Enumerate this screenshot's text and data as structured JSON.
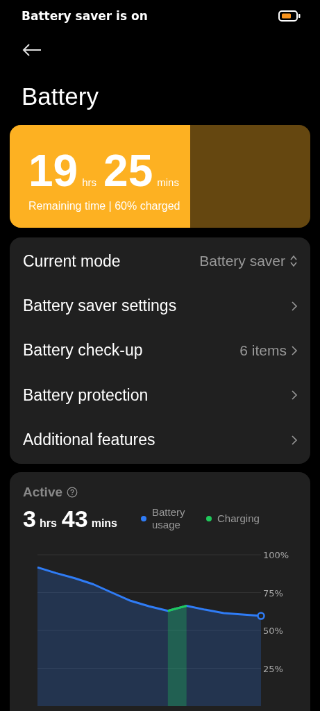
{
  "status_bar": {
    "notice": "Battery saver is on"
  },
  "title": "Battery",
  "summary": {
    "hours": "19",
    "hours_unit": "hrs",
    "minutes": "25",
    "minutes_unit": "mins",
    "caption": "Remaining time | 60% charged",
    "level": 0.6
  },
  "settings": [
    {
      "kind": "select",
      "label": "Current mode",
      "value": "Battery saver"
    },
    {
      "kind": "link",
      "label": "Battery saver settings"
    },
    {
      "kind": "link",
      "label": "Battery check-up",
      "value": "6 items"
    },
    {
      "kind": "link",
      "label": "Battery protection"
    },
    {
      "kind": "link",
      "label": "Additional features"
    }
  ],
  "activity": {
    "title": "Active",
    "hours": "3",
    "hours_unit": "hrs",
    "minutes": "43",
    "minutes_unit": "mins",
    "chart_data": {
      "type": "area",
      "grid": true,
      "ylim": [
        0,
        100
      ],
      "yticks": [
        {
          "value": 100,
          "label": "100%"
        },
        {
          "value": 75,
          "label": "75%"
        },
        {
          "value": 50,
          "label": "50%"
        },
        {
          "value": 25,
          "label": "25%"
        }
      ],
      "series": [
        {
          "name": "Battery usage",
          "color": "#2f7cf6",
          "values": [
            91.7,
            87.9,
            84.5,
            80.5,
            75,
            69.6,
            65.9,
            63,
            66.3,
            63.7,
            61.5,
            60.5,
            59.6
          ]
        },
        {
          "name": "Charging",
          "color": "#1fc85a",
          "values": [
            null,
            null,
            null,
            null,
            null,
            null,
            null,
            63,
            66.3,
            null,
            null,
            null,
            null
          ]
        }
      ]
    }
  }
}
